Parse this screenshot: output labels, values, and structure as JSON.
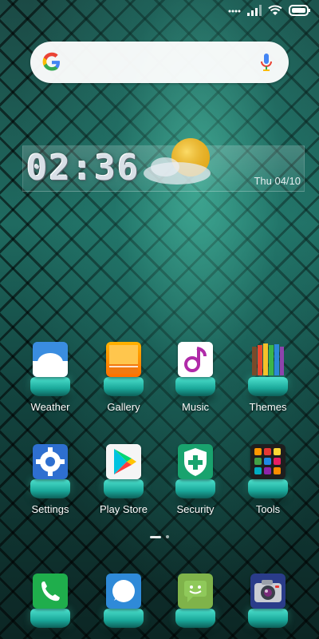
{
  "status_bar": {
    "icons": [
      "dots-icon",
      "signal-icon",
      "wifi-icon",
      "battery-icon"
    ]
  },
  "search": {
    "logo": "google-g-icon",
    "mic": "mic-icon"
  },
  "clock_widget": {
    "time": "02:36",
    "date": "Thu 04/10",
    "weather_icon": "partly-sunny-icon"
  },
  "apps": [
    {
      "label": "Weather",
      "icon": "weather-icon",
      "color": "#2b7fd6"
    },
    {
      "label": "Gallery",
      "icon": "gallery-icon",
      "color": "#f0a020"
    },
    {
      "label": "Music",
      "icon": "music-icon",
      "color": "#b02aa8"
    },
    {
      "label": "Themes",
      "icon": "themes-icon",
      "color": "#e0c050"
    },
    {
      "label": "Settings",
      "icon": "settings-icon",
      "color": "#2e6fd0"
    },
    {
      "label": "Play Store",
      "icon": "play-store-icon",
      "color": "#ffffff"
    },
    {
      "label": "Security",
      "icon": "security-icon",
      "color": "#19a36e"
    },
    {
      "label": "Tools",
      "icon": "tools-icon",
      "color": "#222222"
    }
  ],
  "dock": [
    {
      "icon": "phone-icon",
      "color": "#1fae4c"
    },
    {
      "icon": "messages-icon",
      "color": "#2f8ad8"
    },
    {
      "icon": "chat-icon",
      "color": "#7fb34a"
    },
    {
      "icon": "camera-icon",
      "color": "#2a3c8a"
    }
  ],
  "page_indicator": {
    "pages": 2,
    "current": 1
  }
}
